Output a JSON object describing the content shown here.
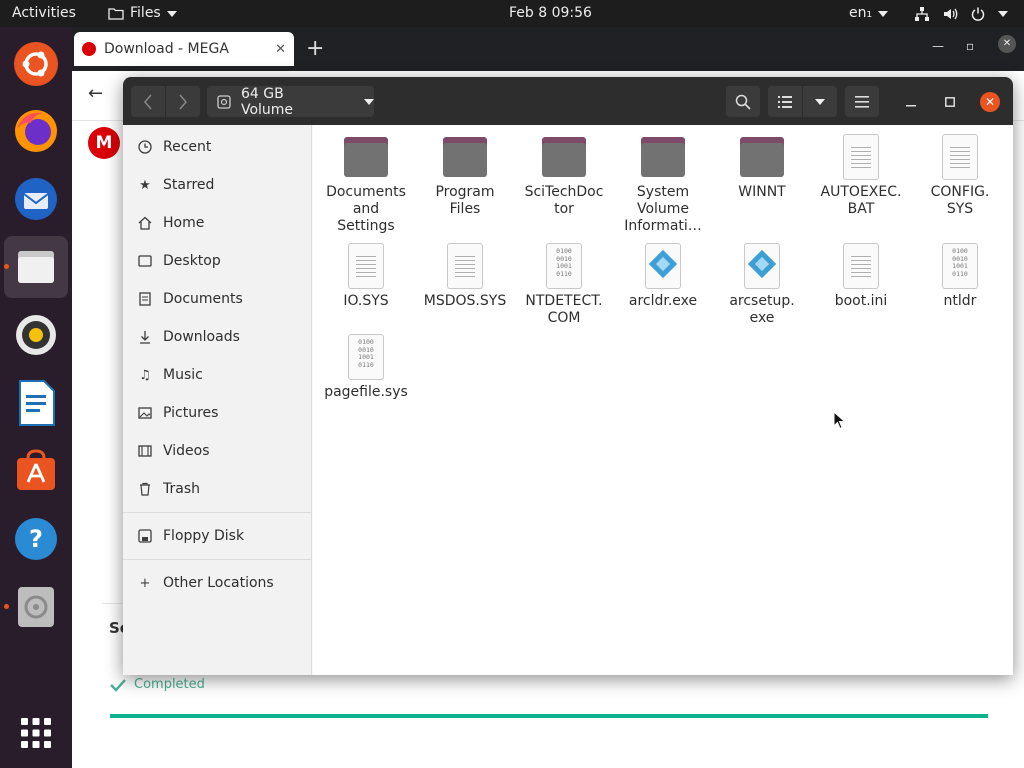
{
  "topbar": {
    "activities": "Activities",
    "app_name": "Files",
    "clock": "Feb 8  09:56",
    "language": "en₁",
    "icons": [
      "network-icon",
      "volume-icon",
      "power-icon"
    ]
  },
  "dock": {
    "items": [
      {
        "name": "ubuntu-software-icon"
      },
      {
        "name": "firefox-icon"
      },
      {
        "name": "thunderbird-icon"
      },
      {
        "name": "files-icon"
      },
      {
        "name": "rhythmbox-icon"
      },
      {
        "name": "writer-icon"
      },
      {
        "name": "app-center-icon"
      },
      {
        "name": "help-icon"
      },
      {
        "name": "disc-icon"
      },
      {
        "name": "show-apps-icon"
      }
    ]
  },
  "browser": {
    "tab_title": "Download - MEGA",
    "so_text": "So",
    "status_text": "Completed",
    "progress_percent": 100,
    "accent": "#0bb38f"
  },
  "files_window": {
    "location": "64 GB Volume",
    "sidebar": [
      {
        "label": "Recent",
        "icon": "clock-icon"
      },
      {
        "label": "Starred",
        "icon": "star-icon"
      },
      {
        "label": "Home",
        "icon": "home-icon"
      },
      {
        "label": "Desktop",
        "icon": "desktop-icon"
      },
      {
        "label": "Documents",
        "icon": "documents-icon"
      },
      {
        "label": "Downloads",
        "icon": "downloads-icon"
      },
      {
        "label": "Music",
        "icon": "music-icon"
      },
      {
        "label": "Pictures",
        "icon": "pictures-icon"
      },
      {
        "label": "Videos",
        "icon": "videos-icon"
      },
      {
        "label": "Trash",
        "icon": "trash-icon"
      },
      {
        "label": "Floppy Disk",
        "icon": "floppy-icon"
      },
      {
        "label": "Other Locations",
        "icon": "plus-icon"
      }
    ],
    "files": [
      {
        "line1": "Documents",
        "line2": "and",
        "line3": "Settings",
        "type": "folder"
      },
      {
        "line1": "Program",
        "line2": "Files",
        "line3": "",
        "type": "folder"
      },
      {
        "line1": "SciTechDoc",
        "line2": "tor",
        "line3": "",
        "type": "folder"
      },
      {
        "line1": "System",
        "line2": "Volume",
        "line3": "Informati…",
        "type": "folder"
      },
      {
        "line1": "WINNT",
        "line2": "",
        "line3": "",
        "type": "folder"
      },
      {
        "line1": "AUTOEXEC.",
        "line2": "BAT",
        "line3": "",
        "type": "text"
      },
      {
        "line1": "CONFIG.",
        "line2": "SYS",
        "line3": "",
        "type": "text"
      },
      {
        "line1": "IO.SYS",
        "line2": "",
        "line3": "",
        "type": "text"
      },
      {
        "line1": "MSDOS.SYS",
        "line2": "",
        "line3": "",
        "type": "text"
      },
      {
        "line1": "NTDETECT.",
        "line2": "COM",
        "line3": "",
        "type": "binary"
      },
      {
        "line1": "arcldr.exe",
        "line2": "",
        "line3": "",
        "type": "exe"
      },
      {
        "line1": "arcsetup.",
        "line2": "exe",
        "line3": "",
        "type": "exe"
      },
      {
        "line1": "boot.ini",
        "line2": "",
        "line3": "",
        "type": "text"
      },
      {
        "line1": "ntldr",
        "line2": "",
        "line3": "",
        "type": "binary"
      },
      {
        "line1": "pagefile.sys",
        "line2": "",
        "line3": "",
        "type": "binary"
      }
    ],
    "binary_glyph": [
      "0100",
      "0010",
      "1001",
      "0110"
    ]
  },
  "colors": {
    "ubuntu_orange": "#e95420",
    "folder_tab": "#7d4b69",
    "folder_body": "#727272",
    "dock_bg": "#2a1d2b"
  }
}
